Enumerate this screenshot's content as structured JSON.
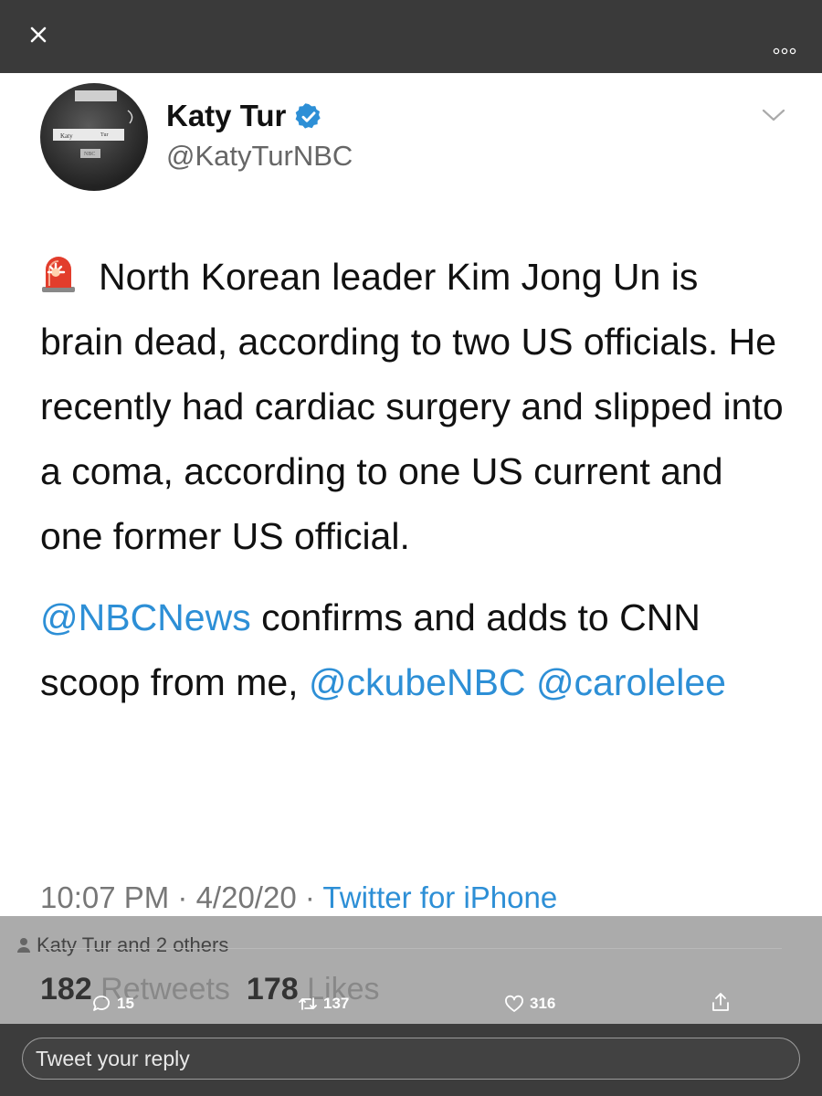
{
  "window": {
    "close_icon": "close-icon",
    "more_icon": "more-horizontal-icon"
  },
  "author": {
    "display_name": "Katy Tur",
    "handle": "@KatyTurNBC",
    "verified": true,
    "avatar_desc": "avatar photo",
    "avatar_labels": [
      "Katy",
      "Tur",
      "NBC"
    ]
  },
  "tweet": {
    "emoji": "rotating-light-siren",
    "paragraph1": "North Korean leader Kim Jong Un is brain dead, according to two US officials. He recently had cardiac surgery and slipped into a coma, according to one US current and one former US official.",
    "paragraph2": {
      "mention1": "@NBCNews",
      "text1": " confirms and adds to CNN scoop from me, ",
      "mention2": "@ckubeNBC",
      "text2": " ",
      "mention3": "@carolelee"
    }
  },
  "meta": {
    "time": "10:07 PM",
    "sep1": " · ",
    "date": "4/20/20",
    "sep2": " · ",
    "source": "Twitter for iPhone"
  },
  "social_context": {
    "text": "Katy Tur and 2 others"
  },
  "stats": {
    "retweets_count": "182",
    "retweets_label": " Retweets",
    "likes_count": "178",
    "likes_label": " Likes"
  },
  "actions": {
    "replies": "15",
    "retweets": "137",
    "likes": "316"
  },
  "reply": {
    "placeholder": "Tweet your reply"
  },
  "colors": {
    "link": "#2d8fd6",
    "verified": "#2d8fd6",
    "topbar": "#3a3a3a"
  }
}
